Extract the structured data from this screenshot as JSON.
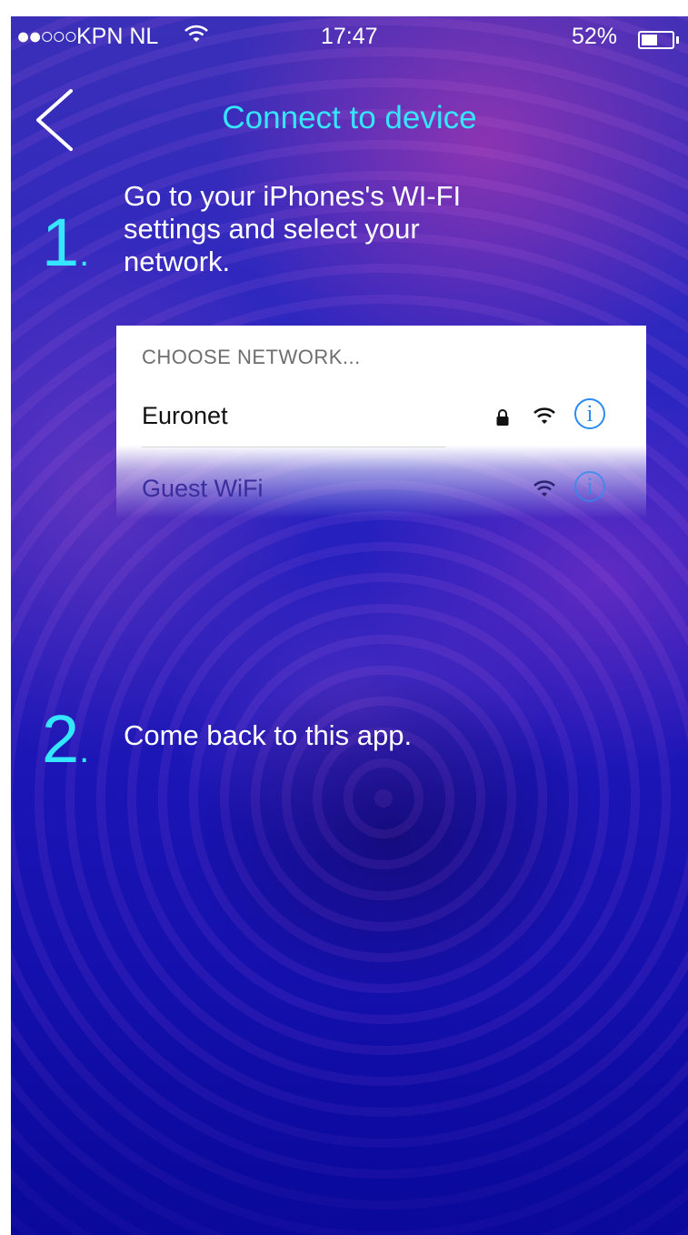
{
  "status_bar": {
    "signal": "●●○○○",
    "carrier": "KPN NL",
    "time": "17:47",
    "battery_percent": "52%",
    "battery_level": 0.52
  },
  "nav": {
    "title": "Connect to device",
    "back_icon": "chevron-left-icon"
  },
  "steps": [
    {
      "number": "1",
      "dot": ".",
      "text_lines": [
        "Go to your iPhones's WI-FI",
        "settings and select your",
        "network."
      ]
    },
    {
      "number": "2",
      "dot": ".",
      "text": "Come back to this app."
    }
  ],
  "network_panel": {
    "header": "CHOOSE NETWORK...",
    "networks": [
      {
        "name": "Euronet",
        "locked": true,
        "icons": [
          "lock-icon",
          "wifi-icon",
          "info-icon"
        ]
      },
      {
        "name": "Guest WiFi",
        "locked": false,
        "icons": [
          "wifi-icon",
          "info-icon"
        ]
      }
    ],
    "info_glyph": "i"
  },
  "colors": {
    "accent": "#35e6ff",
    "info_blue": "#2a8cf0",
    "background": "#2a24c2"
  }
}
